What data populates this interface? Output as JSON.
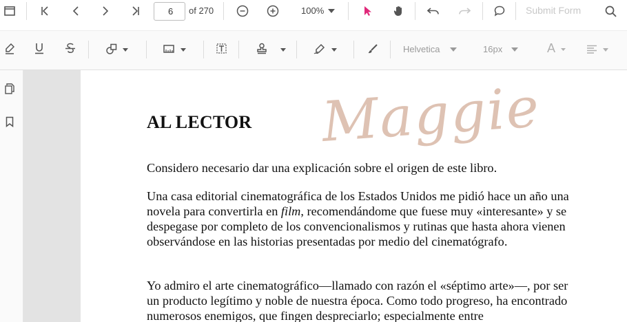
{
  "toolbar": {
    "page_current": "6",
    "page_total": "of 270",
    "zoom": "100%",
    "submit_form": "Submit Form",
    "font_family": "Helvetica",
    "font_size": "16px",
    "text_color_letter": "A"
  },
  "document": {
    "title": "AL LECTOR",
    "signature": "Maggie",
    "p1": "Considero necesario dar una explicación sobre el origen de este libro.",
    "p2_before": "Una casa editorial cinematográfica de los Estados Unidos me pidió hace un año una novela para convertirla en ",
    "p2_italic": "film",
    "p2_after": ", recomendándome que fuese muy «interesante» y se despegase por completo de los convencionalismos y rutinas que hasta ahora vienen observándose en las historias presentadas por medio del cinematógrafo.",
    "p3": "Yo admiro el arte cinematográfico—llamado con razón el «séptimo arte»—, por ser un producto legítimo y noble de nuestra época. Como todo progreso, ha encontrado numerosos enemigos, que fingen despreciarlo; especialmente entre"
  },
  "colors": {
    "accent": "#e0287a",
    "icon": "#555555",
    "gutter": "#e3e3e3"
  },
  "icons": [
    "sidebar-toggle-icon",
    "first-page-icon",
    "previous-page-icon",
    "next-page-icon",
    "last-page-icon",
    "zoom-out-icon",
    "zoom-in-icon",
    "chevron-down-icon",
    "select-cursor-icon",
    "pan-hand-icon",
    "undo-icon",
    "redo-icon",
    "comment-icon",
    "search-icon",
    "highlight-icon",
    "underline-icon",
    "strikethrough-icon",
    "shape-icon",
    "calibrate-icon",
    "textbox-icon",
    "stamp-icon",
    "signature-icon",
    "ink-icon",
    "page-thumbnails-icon",
    "bookmark-icon"
  ]
}
